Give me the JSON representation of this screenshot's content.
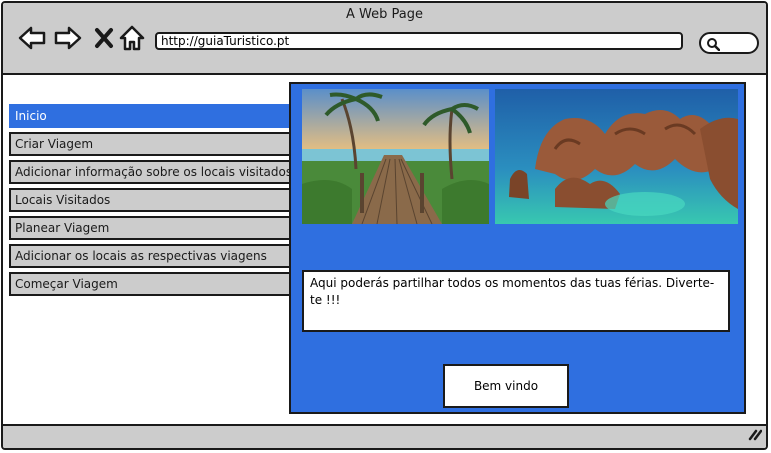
{
  "window": {
    "title": "A Web Page"
  },
  "browser": {
    "url": "http://guiaTuristico.pt",
    "icons": [
      "back-arrow-icon",
      "forward-arrow-icon",
      "close-x-icon",
      "home-icon",
      "search-icon"
    ]
  },
  "sidebar": {
    "items": [
      {
        "label": "Inicio",
        "active": true
      },
      {
        "label": "Criar Viagem",
        "active": false
      },
      {
        "label": "Adicionar informação sobre os locais visitados",
        "active": false
      },
      {
        "label": "Locais Visitados",
        "active": false
      },
      {
        "label": "Planear Viagem",
        "active": false
      },
      {
        "label": "Adicionar os locais as respectivas viagens",
        "active": false
      },
      {
        "label": "Começar Viagem",
        "active": false
      }
    ]
  },
  "main": {
    "images": [
      "beach-boardwalk-photo",
      "coastal-rocks-photo"
    ],
    "description": "Aqui poderás partilhar todos os momentos das tuas férias. Diverte-te !!!",
    "welcome_button": "Bem vindo"
  },
  "colors": {
    "accent": "#2f6fe0",
    "chrome": "#cccccc",
    "border": "#1a1a1a"
  }
}
